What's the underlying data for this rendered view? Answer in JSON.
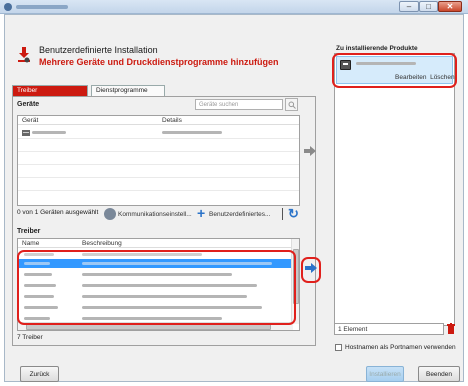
{
  "header": {
    "title": "Benutzerdefinierte Installation",
    "subtitle": "Mehrere Geräte und Druckdienstprogramme hinzufügen"
  },
  "tabs": [
    {
      "label": "Treiber",
      "active": true
    },
    {
      "label": "Dienstprogramme",
      "active": false
    }
  ],
  "devices": {
    "section_label": "Geräte",
    "search_placeholder": "Geräte suchen",
    "columns": [
      "Gerät",
      "Details"
    ],
    "status_text": "0 von 1 Geräten ausgewählt",
    "comm_settings_label": "Kommunikationseinstell...",
    "custom_label": "Benutzerdefiniertes..."
  },
  "drivers": {
    "section_label": "Treiber",
    "columns": [
      "Name",
      "Beschreibung"
    ],
    "count_label": "7 Treiber"
  },
  "products": {
    "title": "Zu installierende Produkte",
    "edit_label": "Bearbeiten",
    "delete_label": "Löschen",
    "count_label": "1 Element"
  },
  "options": {
    "hostname_label": "Hostnamen als Portnamen verwenden",
    "hostname_checked": false
  },
  "buttons": {
    "back": "Zurück",
    "install": "Installieren",
    "close": "Beenden"
  },
  "colors": {
    "accent_red": "#cc1a10",
    "highlight_red": "#e0201c",
    "selection_blue": "#3399ff",
    "action_blue": "#2a73c9"
  }
}
